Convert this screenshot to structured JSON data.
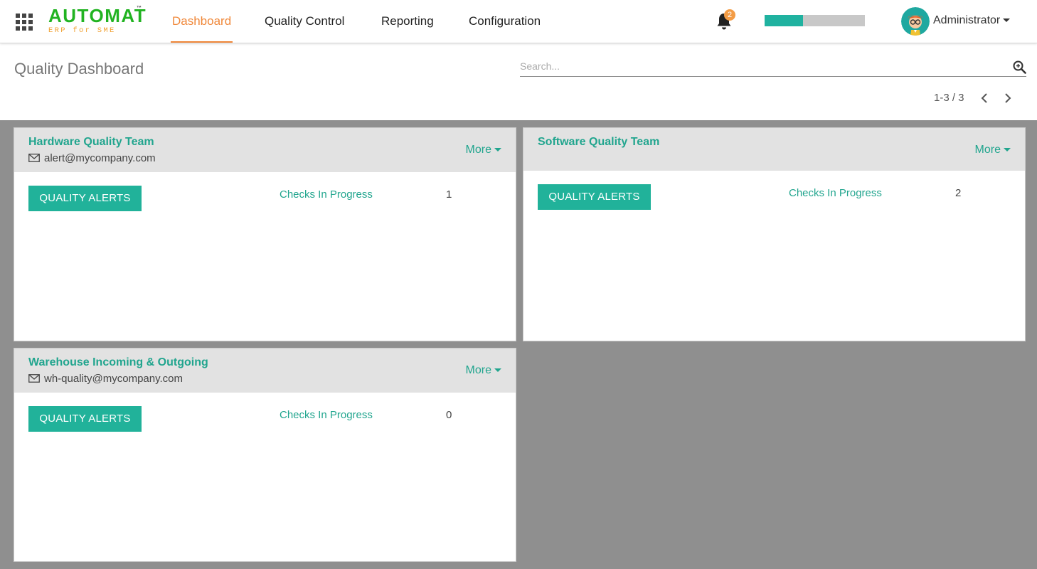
{
  "app": {
    "logo_main": "AUTOMAT",
    "logo_tm": "™",
    "logo_sub": "ERP for SME"
  },
  "nav": {
    "items": [
      {
        "label": "Dashboard",
        "active": true
      },
      {
        "label": "Quality Control",
        "active": false
      },
      {
        "label": "Reporting",
        "active": false
      },
      {
        "label": "Configuration",
        "active": false
      }
    ]
  },
  "header": {
    "notifications_count": "2",
    "progress_fraction": 0.38,
    "user_name": "Administrator"
  },
  "page": {
    "title": "Quality Dashboard",
    "search_placeholder": "Search...",
    "pager": "1-3 / 3"
  },
  "teams": [
    {
      "name": "Hardware Quality Team",
      "email": "alert@mycompany.com",
      "more_label": "More",
      "button_label": "QUALITY ALERTS",
      "checks_label": "Checks In Progress",
      "checks_count": "1"
    },
    {
      "name": "Software Quality Team",
      "email": "",
      "more_label": "More",
      "button_label": "QUALITY ALERTS",
      "checks_label": "Checks In Progress",
      "checks_count": "2"
    },
    {
      "name": "Warehouse Incoming & Outgoing",
      "email": "wh-quality@mycompany.com",
      "more_label": "More",
      "button_label": "QUALITY ALERTS",
      "checks_label": "Checks In Progress",
      "checks_count": "0"
    }
  ],
  "colors": {
    "brand_green": "#21b321",
    "accent_orange": "#f0883a",
    "teal": "#21b29a",
    "kanban_bg": "#8f8f8f"
  }
}
